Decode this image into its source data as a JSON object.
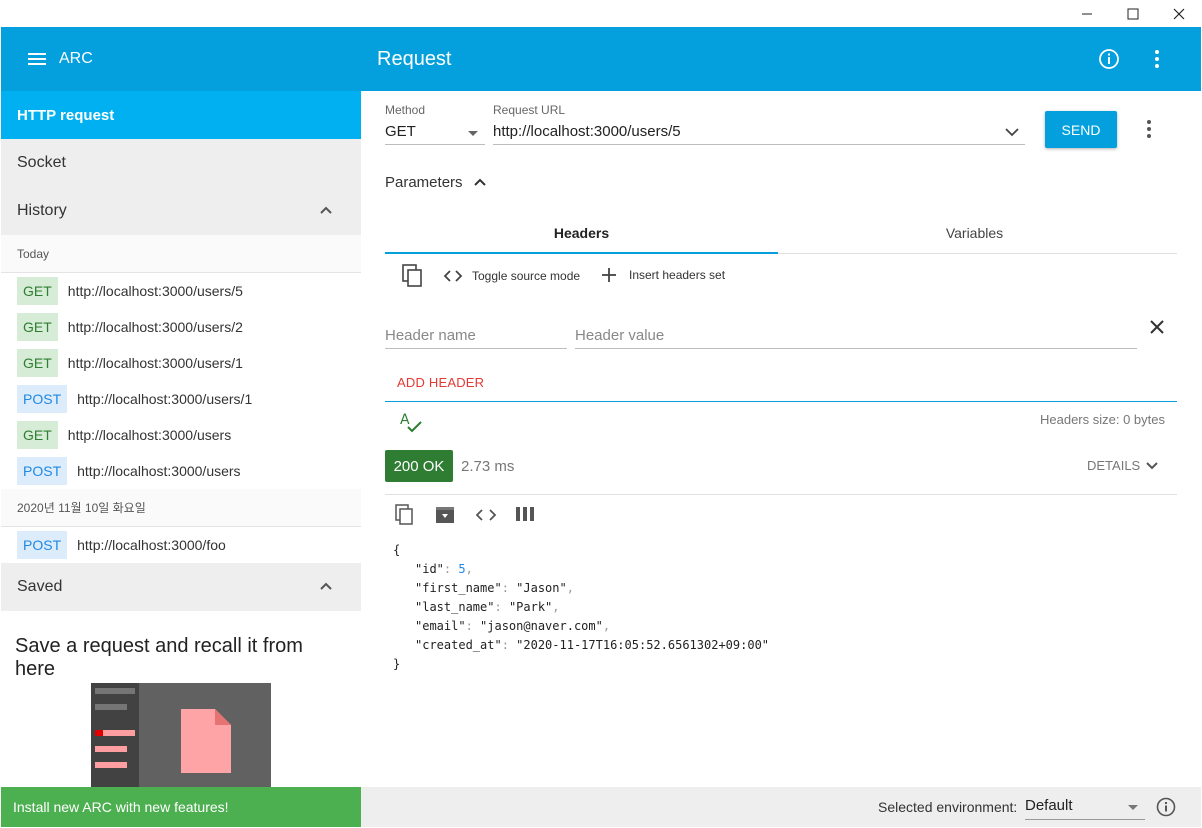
{
  "window": {
    "minimize_icon": "minimize-icon",
    "maximize_icon": "maximize-icon",
    "close_icon": "close-icon"
  },
  "sidebar": {
    "app_title": "ARC",
    "nav": {
      "http_request": "HTTP request",
      "socket": "Socket",
      "history": "History",
      "saved": "Saved"
    },
    "history_groups": [
      {
        "label": "Today",
        "items": [
          {
            "method": "GET",
            "url": "http://localhost:3000/users/5"
          },
          {
            "method": "GET",
            "url": "http://localhost:3000/users/2"
          },
          {
            "method": "GET",
            "url": "http://localhost:3000/users/1"
          },
          {
            "method": "POST",
            "url": "http://localhost:3000/users/1"
          },
          {
            "method": "GET",
            "url": "http://localhost:3000/users"
          },
          {
            "method": "POST",
            "url": "http://localhost:3000/users"
          }
        ]
      },
      {
        "label": "2020년 11월 10일 화요일",
        "items": [
          {
            "method": "POST",
            "url": "http://localhost:3000/foo"
          }
        ]
      }
    ],
    "saved_empty_message": "Save a request and recall it from here",
    "install_banner": "Install new ARC with new features!"
  },
  "header": {
    "title": "Request"
  },
  "request": {
    "method_label": "Method",
    "method_value": "GET",
    "url_label": "Request URL",
    "url_value": "http://localhost:3000/users/5",
    "send_label": "SEND"
  },
  "parameters": {
    "label": "Parameters",
    "tabs": [
      "Headers",
      "Variables"
    ],
    "active_tab": "Headers",
    "toolbar": {
      "toggle_source": "Toggle source mode",
      "insert_set": "Insert headers set"
    },
    "header_name_placeholder": "Header name",
    "header_value_placeholder": "Header value",
    "add_header": "ADD HEADER",
    "headers_size": "Headers size: 0 bytes"
  },
  "response": {
    "status": "200 OK",
    "time": "2.73 ms",
    "details": "DETAILS",
    "body": {
      "open": "{",
      "lines": [
        {
          "key": "\"id\"",
          "value": "5",
          "type": "number"
        },
        {
          "key": "\"first_name\"",
          "value": "\"Jason\"",
          "type": "string"
        },
        {
          "key": "\"last_name\"",
          "value": "\"Park\"",
          "type": "string"
        },
        {
          "key": "\"email\"",
          "value": "\"jason@naver.com\"",
          "type": "string"
        },
        {
          "key": "\"created_at\"",
          "value": "\"2020-11-17T16:05:52.6561302+09:00\"",
          "type": "string"
        }
      ],
      "close": "}"
    }
  },
  "footer": {
    "env_label": "Selected environment:",
    "env_value": "Default"
  },
  "colors": {
    "primary": "#03a0dd",
    "active_nav": "#00b0f0",
    "status_ok": "#2e7d32",
    "install_green": "#4caf50",
    "add_header_red": "#e53935"
  }
}
